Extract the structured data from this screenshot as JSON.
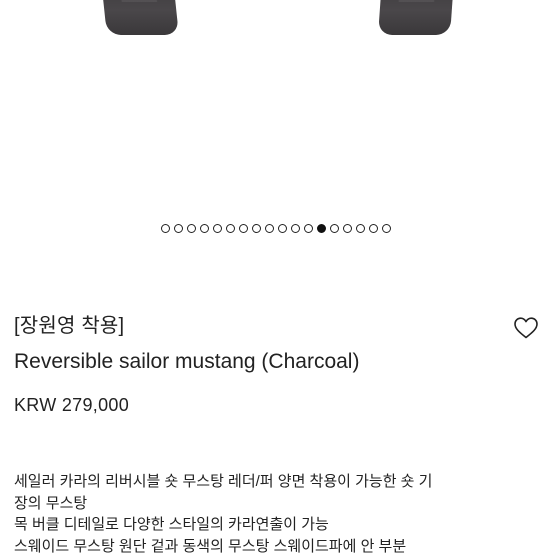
{
  "product_gallery": {
    "slide_count": 18,
    "active_index": 12
  },
  "product": {
    "label": "[장원영 착용]",
    "name": "Reversible sailor mustang (Charcoal)",
    "price": "KRW 279,000"
  },
  "icons": {
    "wishlist": "heart-icon"
  },
  "description": {
    "lines": [
      "세일러 카라의 리버시블 숏 무스탕 레더/퍼 양면 착용이 가능한 숏 기",
      "장의 무스탕",
      "목 버클 디테일로 다양한 스타일의 카라연출이 가능",
      "스웨이드 무스탕 원단 겉과 동색의 무스탕 스웨이드파에 안 부분"
    ]
  },
  "colors": {
    "text": "#222222",
    "garment": "#403e40",
    "background": "#ffffff"
  }
}
